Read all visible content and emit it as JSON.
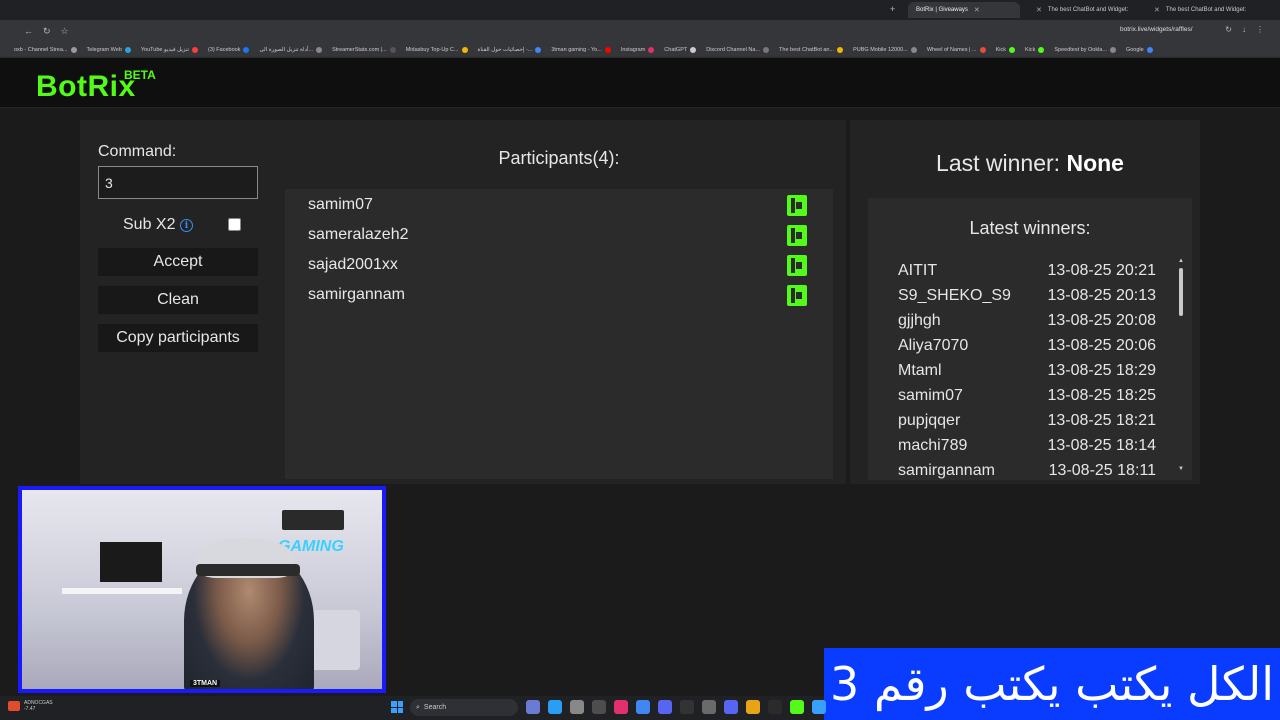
{
  "browser": {
    "tabs": [
      {
        "label": "BotRix | Giveaways",
        "active": true
      },
      {
        "label": "The best ChatBot and Widget:",
        "active": false
      },
      {
        "label": "The best ChatBot and Widget:",
        "active": false
      }
    ],
    "url": "botrix.live/widgets/raffles/",
    "bookmarks": [
      {
        "label": "oxb - Channel Strea...",
        "color": "#9b9b9b"
      },
      {
        "label": "Telegram Web",
        "color": "#2aa3de"
      },
      {
        "label": "YouTube تنزيل فيديو",
        "color": "#ff3b3b"
      },
      {
        "label": "(3) Facebook",
        "color": "#1877f2"
      },
      {
        "label": "أداة تنزيل الصورة الى...",
        "color": "#888888"
      },
      {
        "label": "StreamerStats.com |...",
        "color": "#555555"
      },
      {
        "label": "Midasbuy Top-Up C...",
        "color": "#f2b705"
      },
      {
        "label": "إحصائيات حول القناة -...",
        "color": "#4285f4"
      },
      {
        "label": "3tman gaming - Yo...",
        "color": "#ff0000"
      },
      {
        "label": "Instagram",
        "color": "#e1306c"
      },
      {
        "label": "ChatGPT",
        "color": "#cccccc"
      },
      {
        "label": "Discord Channel Na...",
        "color": "#777777"
      },
      {
        "label": "The best ChatBot an...",
        "color": "#f2b705"
      },
      {
        "label": "PUBG Mobile 12000...",
        "color": "#888888"
      },
      {
        "label": "Wheel of Names | ...",
        "color": "#e84b3c"
      },
      {
        "label": "Kick",
        "color": "#53fc18"
      },
      {
        "label": "Kick",
        "color": "#53fc18"
      },
      {
        "label": "Speedtest by Ookla...",
        "color": "#888888"
      },
      {
        "label": "Google",
        "color": "#4285f4"
      }
    ]
  },
  "header": {
    "logo": "BotRix",
    "badge": "BETA"
  },
  "form": {
    "command_label": "Command:",
    "command_value": "3",
    "sub_label": "Sub X2",
    "sub_checked": false,
    "accept_label": "Accept",
    "clean_label": "Clean",
    "copy_label": "Copy participants"
  },
  "participants": {
    "title": "Participants(4):",
    "items": [
      "samim07",
      "sameralazeh2",
      "sajad2001xx",
      "samirgannam"
    ]
  },
  "winners": {
    "last_label": "Last winner:",
    "last_value": "None",
    "latest_title": "Latest winners:",
    "list": [
      {
        "name": "AITIT",
        "time": "13-08-25 20:21"
      },
      {
        "name": "S9_SHEKO_S9",
        "time": "13-08-25 20:13"
      },
      {
        "name": "gjjhgh",
        "time": "13-08-25 20:08"
      },
      {
        "name": "Aliya7070",
        "time": "13-08-25 20:06"
      },
      {
        "name": "Mtaml",
        "time": "13-08-25 18:29"
      },
      {
        "name": "samim07",
        "time": "13-08-25 18:25"
      },
      {
        "name": "pupjqqer",
        "time": "13-08-25 18:21"
      },
      {
        "name": "machi789",
        "time": "13-08-25 18:14"
      },
      {
        "name": "samirgannam",
        "time": "13-08-25 18:11"
      }
    ]
  },
  "webcam": {
    "wall_text": "GAMING",
    "tag": "3TMAN"
  },
  "caption": "الكل يكتب يكتب رقم 3",
  "taskbar": {
    "weather_label": "ADNOCGAS",
    "weather_value": "-7.47",
    "search_placeholder": "Search"
  },
  "colors": {
    "accent": "#53fc18",
    "caption_bg": "#0a3cff",
    "webcam_border": "#1a1aff"
  }
}
